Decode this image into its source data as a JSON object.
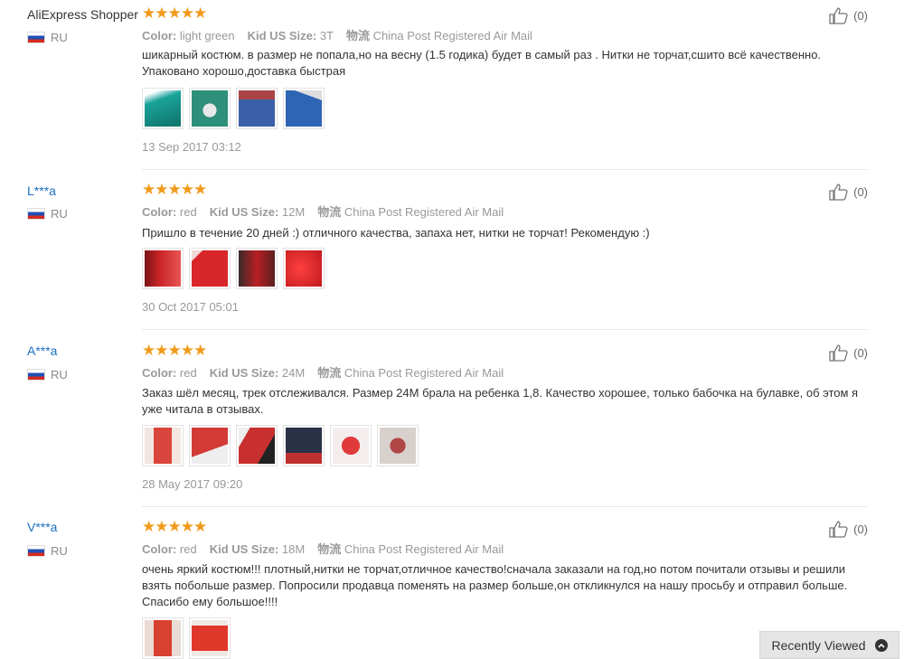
{
  "labels": {
    "color": "Color:",
    "size": "Kid US Size:",
    "shipping": "物流"
  },
  "reviews": [
    {
      "name": "AliExpress Shopper",
      "country": "RU",
      "stars": "★★★★★",
      "color": "light green",
      "size": "3T",
      "shipping": "China Post Registered Air Mail",
      "text": "шикарный костюм. в размер не попала,но на весну (1.5 годика) будет в самый раз . Нитки не торчат,сшито всё качественно. Упаковано хорошо,доставка быстрая",
      "date": "13 Sep 2017 03:12",
      "likes": "(0)",
      "thumbs": [
        {
          "icon": "photo-teal-shirt",
          "color": "#1aa39a"
        },
        {
          "icon": "photo-print-shirt",
          "color": "#2e8f7a"
        },
        {
          "icon": "photo-blue-pants",
          "color": "#3b5fa8"
        },
        {
          "icon": "photo-blue-shirt",
          "color": "#2f65b5"
        }
      ]
    },
    {
      "name": "L***a",
      "country": "RU",
      "stars": "★★★★★",
      "color": "red",
      "size": "12M",
      "shipping": "China Post Registered Air Mail",
      "text": "Пришло в течение 20 дней :) отличного качества, запаха нет, нитки не торчат! Рекомендую :)",
      "date": "30 Oct 2017 05:01",
      "likes": "(0)",
      "thumbs": [
        {
          "icon": "photo-red-suit",
          "color": "#c92326"
        },
        {
          "icon": "photo-red-suit-2",
          "color": "#d8262a"
        },
        {
          "icon": "photo-red-jacket",
          "color": "#b81f24"
        },
        {
          "icon": "photo-red-fabric",
          "color": "#e0262a"
        }
      ]
    },
    {
      "name": "A***a",
      "country": "RU",
      "stars": "★★★★★",
      "color": "red",
      "size": "24M",
      "shipping": "China Post Registered Air Mail",
      "text": "Заказ шёл месяц, трек отслеживался. Размер 24М брала на ребенка 1,8. Качество хорошее, только бабочка на булавке, об этом я уже читала в отзывах.",
      "date": "28 May 2017 09:20",
      "likes": "(0)",
      "thumbs": [
        {
          "icon": "photo-child-suit",
          "color": "#d9453c"
        },
        {
          "icon": "photo-red-pants",
          "color": "#d23a36"
        },
        {
          "icon": "photo-red-shirt",
          "color": "#c8302f"
        },
        {
          "icon": "photo-dark-pants",
          "color": "#2a3247"
        },
        {
          "icon": "photo-red-bowtie",
          "color": "#e03a3a"
        },
        {
          "icon": "photo-bowtie-grey",
          "color": "#b04646"
        }
      ]
    },
    {
      "name": "V***a",
      "country": "RU",
      "stars": "★★★★★",
      "color": "red",
      "size": "18M",
      "shipping": "China Post Registered Air Mail",
      "text": "очень яркий костюм!!! плотный,нитки не торчат,отличное качество!сначала заказали на год,но потом почитали отзывы и решили взять побольше размер. Попросили продавца поменять на размер больше,он откликнулся на нашу просьбу и отправил больше. Спасибо ему большое!!!!",
      "date": "",
      "likes": "(0)",
      "thumbs": [
        {
          "icon": "photo-child-red",
          "color": "#d8412f"
        },
        {
          "icon": "photo-red-outfit",
          "color": "#e0372b"
        }
      ]
    }
  ],
  "recently_viewed": "Recently Viewed"
}
